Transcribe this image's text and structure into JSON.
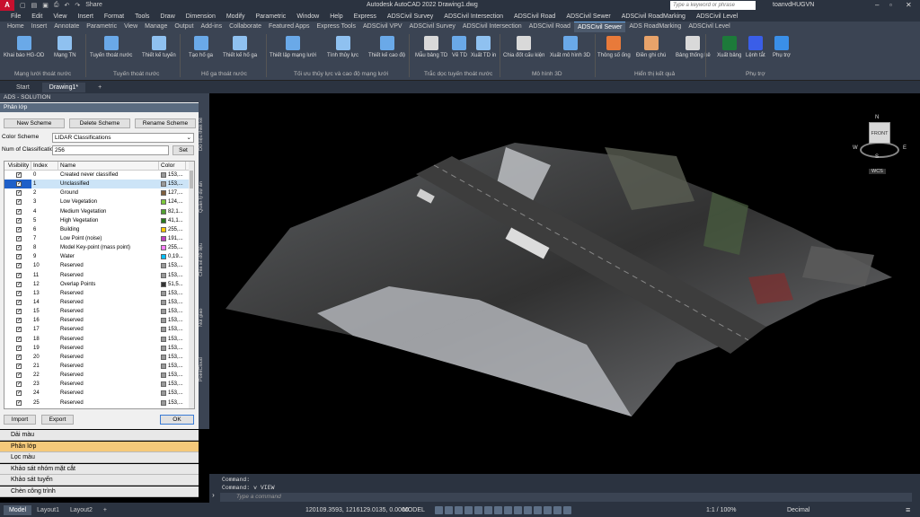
{
  "app": {
    "logo": "A",
    "title": "Autodesk AutoCAD 2022    Drawing1.dwg",
    "search_placeholder": "Type a keyword or phrase",
    "user": "toanvdHUGVN",
    "share": "Share"
  },
  "menu": [
    "File",
    "Edit",
    "View",
    "Insert",
    "Format",
    "Tools",
    "Draw",
    "Dimension",
    "Modify",
    "Parametric",
    "Window",
    "Help",
    "Express",
    "ADSCivil Survey",
    "ADSCivil Intersection",
    "ADSCivil Road",
    "ADSCivil Sewer",
    "ADSCivil RoadMarking",
    "ADSCivil Level"
  ],
  "ribbon_tabs": [
    {
      "label": "Home",
      "active": false
    },
    {
      "label": "Insert",
      "active": false
    },
    {
      "label": "Annotate",
      "active": false
    },
    {
      "label": "Parametric",
      "active": false
    },
    {
      "label": "View",
      "active": false
    },
    {
      "label": "Manage",
      "active": false
    },
    {
      "label": "Output",
      "active": false
    },
    {
      "label": "Add-ins",
      "active": false
    },
    {
      "label": "Collaborate",
      "active": false
    },
    {
      "label": "Featured Apps",
      "active": false
    },
    {
      "label": "Express Tools",
      "active": false
    },
    {
      "label": "ADSCivil VPV",
      "active": false
    },
    {
      "label": "ADSCivil Survey",
      "active": false
    },
    {
      "label": "ADSCivil Intersection",
      "active": false
    },
    {
      "label": "ADSCivil Road",
      "active": false
    },
    {
      "label": "ADSCivil Sewer",
      "active": true
    },
    {
      "label": "ADS RoadMarking",
      "active": false
    },
    {
      "label": "ADSCivil Level",
      "active": false
    }
  ],
  "ribbon_buttons": [
    {
      "label": "Khai báo HG-OD",
      "color": "#6aa9e8"
    },
    {
      "label": "Mạng TN",
      "color": "#8fc1f0"
    },
    {
      "label": "Tuyến thoát nước",
      "color": "#6aa9e8"
    },
    {
      "label": "Thiết kế tuyến",
      "color": "#8fc1f0"
    },
    {
      "label": "Tạo hố ga",
      "color": "#6aa9e8"
    },
    {
      "label": "Thiết kế hố ga",
      "color": "#8fc1f0"
    },
    {
      "label": "Thiết lập mạng lưới",
      "color": "#6aa9e8"
    },
    {
      "label": "Tính thủy lực",
      "color": "#8fc1f0"
    },
    {
      "label": "Thiết kế cao độ",
      "color": "#6aa9e8"
    },
    {
      "label": "Mẫu bảng TD",
      "color": "#d9d9d9"
    },
    {
      "label": "Vẽ TD",
      "color": "#6aa9e8"
    },
    {
      "label": "Xuất TD in",
      "color": "#8fc1f0"
    },
    {
      "label": "Chia đốt cấu kiện",
      "color": "#d9d9d9"
    },
    {
      "label": "Xuất mô hình 3D",
      "color": "#6aa9e8"
    },
    {
      "label": "Thông số ống",
      "color": "#e87a3a"
    },
    {
      "label": "Điền ghi chú",
      "color": "#e8a36a"
    },
    {
      "label": "Bảng thống kê",
      "color": "#d9d9d9"
    },
    {
      "label": "Xuất bảng",
      "color": "#1d7a3a"
    },
    {
      "label": "Lệnh tắt",
      "color": "#3a5ee8"
    },
    {
      "label": "Phụ trợ",
      "color": "#3a8fe8"
    }
  ],
  "ribbon_groups": [
    "Mạng lưới thoát nước",
    "Tuyến thoát nước",
    "Hố ga thoát nước",
    "Tối ưu thủy lực và cao độ mạng lưới",
    "Trắc dọc tuyến thoát nước",
    "Mô hình 3D",
    "Hiển thị kết quả",
    "Phụ trợ"
  ],
  "doc_tabs": [
    {
      "label": "Start",
      "active": false
    },
    {
      "label": "Drawing1*",
      "active": true
    },
    {
      "label": "+",
      "active": false
    }
  ],
  "panel": {
    "header": "ADS - SOLUTION",
    "section": "Phân lớp",
    "new_scheme": "New Scheme",
    "delete_scheme": "Delete Scheme",
    "rename_scheme": "Rename Scheme",
    "color_scheme_label": "Color Scheme",
    "color_scheme_value": "LIDAR Classifications",
    "num_class_label": "Num of Classification",
    "num_class_value": "256",
    "set": "Set",
    "columns": [
      "Visibility",
      "Index",
      "Name",
      "Color"
    ],
    "rows": [
      {
        "index": "0",
        "name": "Created never classified",
        "color": "153,...",
        "swatch": "#999999"
      },
      {
        "index": "1",
        "name": "Unclassified",
        "color": "153,...",
        "swatch": "#999999",
        "selected": true
      },
      {
        "index": "2",
        "name": "Ground",
        "color": "127,...",
        "swatch": "#7f5f3f"
      },
      {
        "index": "3",
        "name": "Low Vegetation",
        "color": "124,...",
        "swatch": "#7cc83c"
      },
      {
        "index": "4",
        "name": "Medium Vegetation",
        "color": "82,1...",
        "swatch": "#52a032"
      },
      {
        "index": "5",
        "name": "High Vegetation",
        "color": "41,1...",
        "swatch": "#29781e"
      },
      {
        "index": "6",
        "name": "Building",
        "color": "255,...",
        "swatch": "#ffc800"
      },
      {
        "index": "7",
        "name": "Low Point (noise)",
        "color": "191,...",
        "swatch": "#bf3fbf"
      },
      {
        "index": "8",
        "name": "Model Key-point (mass point)",
        "color": "255,...",
        "swatch": "#ff80ff"
      },
      {
        "index": "9",
        "name": "Water",
        "color": "0,19...",
        "swatch": "#00bfff"
      },
      {
        "index": "10",
        "name": "Reserved",
        "color": "153,...",
        "swatch": "#999999"
      },
      {
        "index": "11",
        "name": "Reserved",
        "color": "153,...",
        "swatch": "#999999"
      },
      {
        "index": "12",
        "name": "Overlap Points",
        "color": "51,5...",
        "swatch": "#333333"
      },
      {
        "index": "13",
        "name": "Reserved",
        "color": "153,...",
        "swatch": "#999999"
      },
      {
        "index": "14",
        "name": "Reserved",
        "color": "153,...",
        "swatch": "#999999"
      },
      {
        "index": "15",
        "name": "Reserved",
        "color": "153,...",
        "swatch": "#999999"
      },
      {
        "index": "16",
        "name": "Reserved",
        "color": "153,...",
        "swatch": "#999999"
      },
      {
        "index": "17",
        "name": "Reserved",
        "color": "153,...",
        "swatch": "#999999"
      },
      {
        "index": "18",
        "name": "Reserved",
        "color": "153,...",
        "swatch": "#999999"
      },
      {
        "index": "19",
        "name": "Reserved",
        "color": "153,...",
        "swatch": "#999999"
      },
      {
        "index": "20",
        "name": "Reserved",
        "color": "153,...",
        "swatch": "#999999"
      },
      {
        "index": "21",
        "name": "Reserved",
        "color": "153,...",
        "swatch": "#999999"
      },
      {
        "index": "22",
        "name": "Reserved",
        "color": "153,...",
        "swatch": "#999999"
      },
      {
        "index": "23",
        "name": "Reserved",
        "color": "153,...",
        "swatch": "#999999"
      },
      {
        "index": "24",
        "name": "Reserved",
        "color": "153,...",
        "swatch": "#999999"
      },
      {
        "index": "25",
        "name": "Reserved",
        "color": "153,...",
        "swatch": "#999999"
      },
      {
        "index": "26",
        "name": "Reserved",
        "color": "153,...",
        "swatch": "#999999"
      }
    ],
    "import": "Import",
    "export": "Export",
    "ok": "OK"
  },
  "accordion": [
    {
      "label": "Dải màu",
      "highlight": false
    },
    {
      "label": "Phân lớp",
      "highlight": true
    },
    {
      "label": "Lọc màu",
      "highlight": false
    },
    {
      "label": "Khảo sát nhóm mặt cắt",
      "highlight": false
    },
    {
      "label": "Khảo sát tuyến",
      "highlight": false
    },
    {
      "label": "Chèn công trình",
      "highlight": false
    }
  ],
  "side_tabs": [
    "Dữ liệu thiết kế",
    "Quản lý dự án",
    "Chia sẻ dữ liệu",
    "Nút giao",
    "PointCloud"
  ],
  "viewcube": {
    "face": "FRONT",
    "wcs": "WCS",
    "n": "N",
    "e": "E",
    "s": "S",
    "w": "W"
  },
  "command": {
    "line1": "Command:",
    "line2": "Command: v VIEW",
    "placeholder": "Type a command"
  },
  "status": {
    "tabs": [
      {
        "label": "Model",
        "active": true
      },
      {
        "label": "Layout1",
        "active": false
      },
      {
        "label": "Layout2",
        "active": false
      },
      {
        "label": "+",
        "active": false
      }
    ],
    "coords": "120109.3593, 1216129.0135, 0.0000",
    "mode": "MODEL",
    "scale": "1:1 / 100%",
    "units": "Decimal"
  }
}
